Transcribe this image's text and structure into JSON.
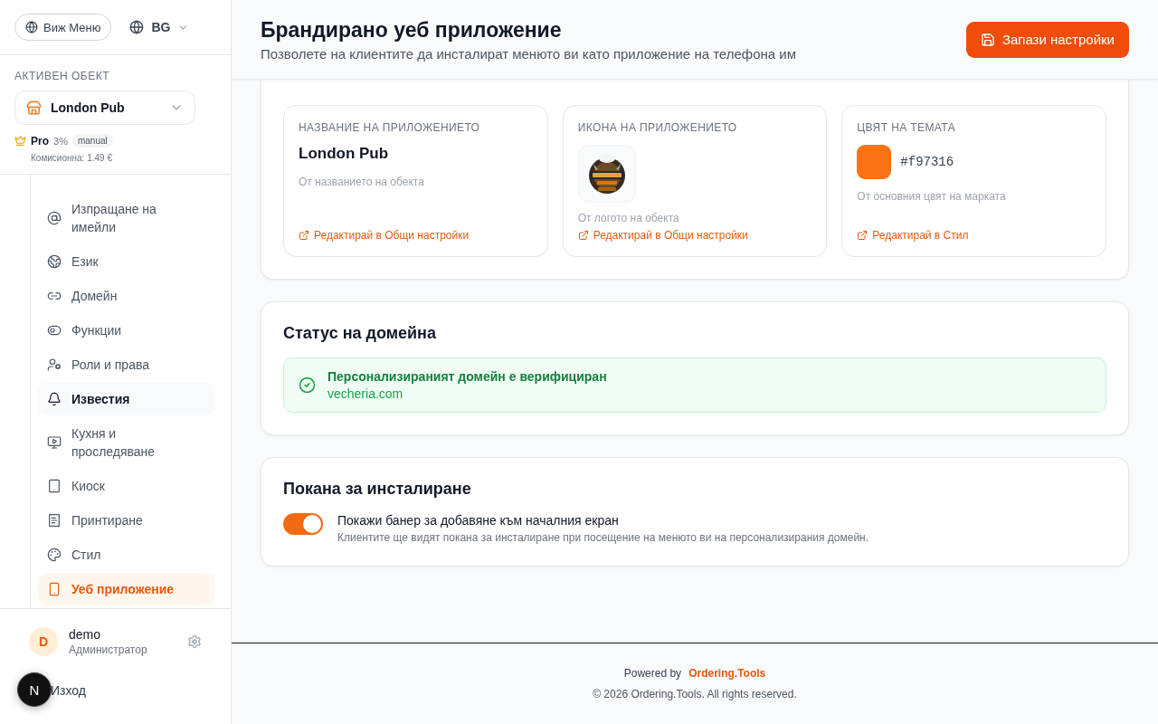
{
  "sidebar": {
    "view_menu_button": "Виж Меню",
    "language": "BG",
    "active_object": {
      "label": "АКТИВЕН ОБЕКТ",
      "name": "London Pub",
      "plan": "Pro",
      "percent": "3%",
      "mode_badge": "manual",
      "commission": "Комисионна: 1.49 €"
    },
    "nav_items": [
      {
        "label": "Изпращане на имейли",
        "kind": "at",
        "selected": false,
        "hovered": false
      },
      {
        "label": "Език",
        "kind": "globe",
        "selected": false,
        "hovered": false
      },
      {
        "label": "Домейн",
        "kind": "link",
        "selected": false,
        "hovered": false
      },
      {
        "label": "Функции",
        "kind": "toggle",
        "selected": false,
        "hovered": false
      },
      {
        "label": "Роли и права",
        "kind": "roles",
        "selected": false,
        "hovered": false
      },
      {
        "label": "Известия",
        "kind": "bell",
        "selected": false,
        "hovered": true
      },
      {
        "label": "Кухня и проследяване",
        "kind": "monitor",
        "selected": false,
        "hovered": false
      },
      {
        "label": "Киоск",
        "kind": "tablet",
        "selected": false,
        "hovered": false
      },
      {
        "label": "Принтиране",
        "kind": "receipt",
        "selected": false,
        "hovered": false
      },
      {
        "label": "Стил",
        "kind": "palette",
        "selected": false,
        "hovered": false
      },
      {
        "label": "Уеб приложение",
        "kind": "phone",
        "selected": true,
        "hovered": false
      }
    ],
    "user": {
      "initial": "D",
      "name": "demo",
      "role": "Администратор"
    },
    "logout": "Изход"
  },
  "dev_badge": "N",
  "header": {
    "title": "Брандирано уеб приложение",
    "subtitle": "Позволете на клиентите да инсталират менюто ви като приложение на телефона им",
    "save_button": "Запази настройки"
  },
  "app_cards": [
    {
      "kind": "name",
      "label": "НАЗВАНИЕ НА ПРИЛОЖЕНИЕТО",
      "value": "London Pub",
      "hint": "От названието на обекта",
      "link": "Редактирай в Общи настройки"
    },
    {
      "kind": "icon",
      "label": "ИКОНА НА ПРИЛОЖЕНИЕТО",
      "hint": "От логото на обекта",
      "link": "Редактирай в Общи настройки"
    },
    {
      "kind": "color",
      "label": "ЦВЯТ НА ТЕМАТА",
      "value": "#f97316",
      "color": "#f97316",
      "hint": "От основния цвят на марката",
      "link": "Редактирай в Стил"
    }
  ],
  "domain_status": {
    "title": "Статус на домейна",
    "verified": true,
    "message": "Персонализираният домейн е верифициран",
    "domain": "vecheria.com"
  },
  "install_prompt": {
    "title": "Покана за инсталиране",
    "toggle": {
      "on": true,
      "label": "Покажи банер за добавяне към началния екран",
      "description": "Клиентите ще видят покана за инсталиране при посещение на менюто ви на персонализирания домейн."
    }
  },
  "footer": {
    "powered_by": "Powered by",
    "brand": "Ordering.Tools",
    "copyright": "© 2026 Ordering.Tools. All rights reserved."
  }
}
